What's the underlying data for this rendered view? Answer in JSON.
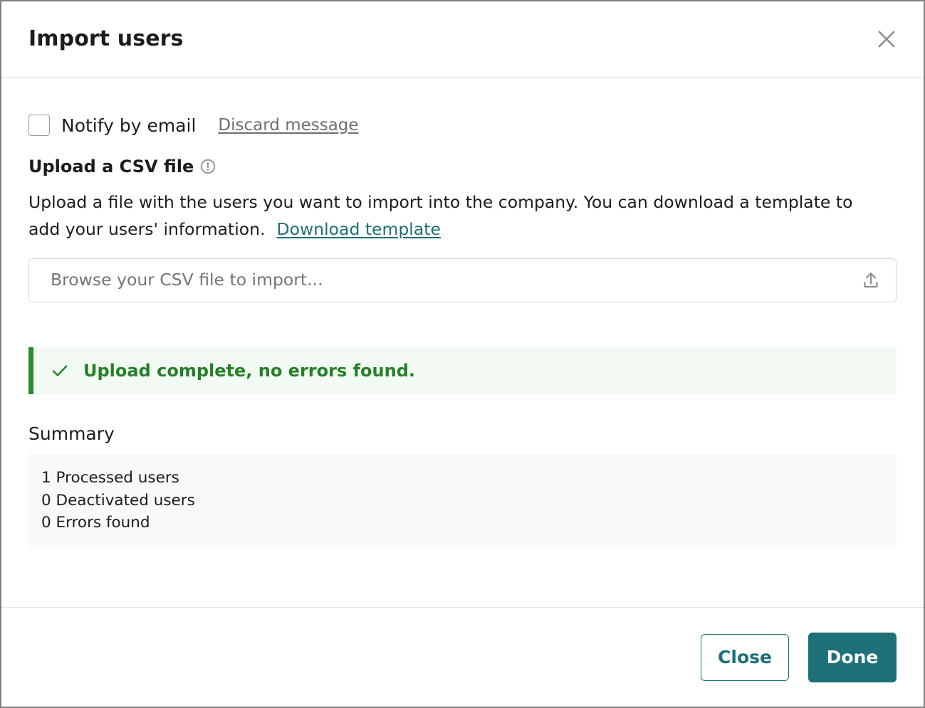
{
  "dialog": {
    "title": "Import users",
    "close_icon": "close-icon"
  },
  "notify": {
    "label": "Notify by email",
    "checked": false,
    "discard_link": "Discard message"
  },
  "upload_section": {
    "heading": "Upload a CSV file",
    "info_icon": "exclamation-circle-icon",
    "description": "Upload a file with the users you want to import into the company. You can download a template to add your users' information.",
    "download_link": "Download template",
    "file_input_placeholder": "Browse your CSV file to import...",
    "upload_icon": "upload-icon"
  },
  "alert": {
    "icon": "check-icon",
    "message": "Upload complete, no errors found.",
    "accent_color": "#2a8a2e",
    "background_color": "#f3f9f3",
    "text_color": "#268028"
  },
  "summary": {
    "heading": "Summary",
    "lines": [
      "1 Processed users",
      "0 Deactivated users",
      "0 Errors found"
    ]
  },
  "footer": {
    "close_label": "Close",
    "done_label": "Done",
    "accent_color": "#1d7078"
  }
}
